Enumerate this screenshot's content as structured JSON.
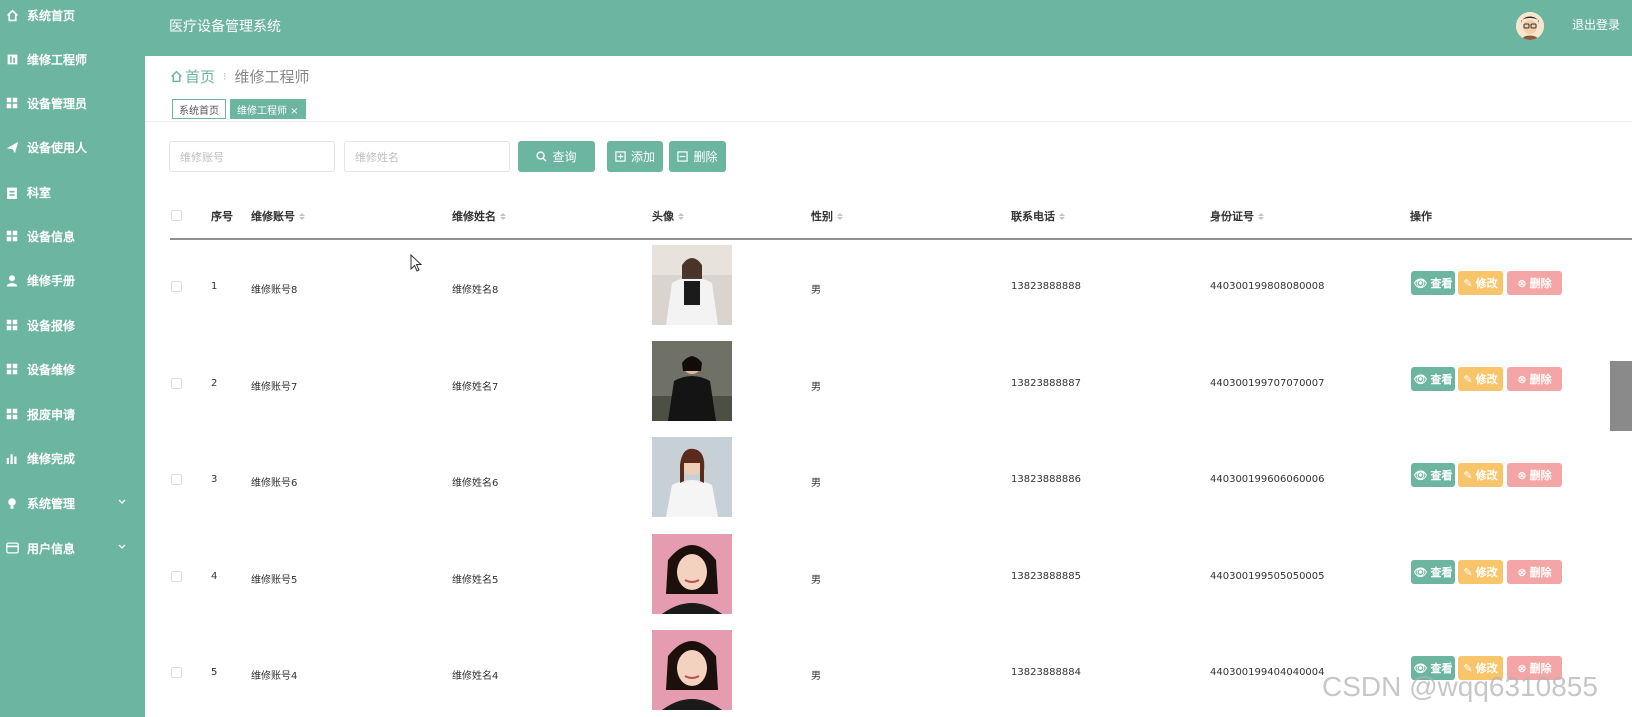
{
  "sidebar": {
    "items": [
      {
        "label": "系统首页",
        "icon": "home-icon"
      },
      {
        "label": "维修工程师",
        "icon": "book-icon"
      },
      {
        "label": "设备管理员",
        "icon": "grid-icon"
      },
      {
        "label": "设备使用人",
        "icon": "send-icon"
      },
      {
        "label": "科室",
        "icon": "clipboard-icon"
      },
      {
        "label": "设备信息",
        "icon": "grid-icon"
      },
      {
        "label": "维修手册",
        "icon": "user-icon"
      },
      {
        "label": "设备报修",
        "icon": "grid-icon"
      },
      {
        "label": "设备维修",
        "icon": "grid-icon"
      },
      {
        "label": "报废申请",
        "icon": "grid-icon"
      },
      {
        "label": "维修完成",
        "icon": "bar-chart-icon"
      },
      {
        "label": "系统管理",
        "icon": "bulb-icon"
      },
      {
        "label": "用户信息",
        "icon": "card-icon"
      }
    ]
  },
  "header": {
    "title": "医疗设备管理系统",
    "logout": "退出登录"
  },
  "breadcrumb": {
    "home": "首页",
    "separator": "⁝",
    "current": "维修工程师"
  },
  "tags": {
    "home": "系统首页",
    "active": "维修工程师 ×"
  },
  "search": {
    "account_placeholder": "维修账号",
    "name_placeholder": "维修姓名",
    "query_label": "查询",
    "add_label": "添加",
    "delete_label": "删除"
  },
  "table": {
    "headers": {
      "index": "序号",
      "account": "维修账号",
      "name": "维修姓名",
      "avatar": "头像",
      "gender": "性别",
      "phone": "联系电话",
      "idcard": "身份证号",
      "action": "操作"
    },
    "rows": [
      {
        "index": "1",
        "account": "维修账号8",
        "name": "维修姓名8",
        "gender": "男",
        "phone": "13823888888",
        "idcard": "440300199808080008"
      },
      {
        "index": "2",
        "account": "维修账号7",
        "name": "维修姓名7",
        "gender": "男",
        "phone": "13823888887",
        "idcard": "440300199707070007"
      },
      {
        "index": "3",
        "account": "维修账号6",
        "name": "维修姓名6",
        "gender": "男",
        "phone": "13823888886",
        "idcard": "440300199606060006"
      },
      {
        "index": "4",
        "account": "维修账号5",
        "name": "维修姓名5",
        "gender": "男",
        "phone": "13823888885",
        "idcard": "440300199505050005"
      },
      {
        "index": "5",
        "account": "维修账号4",
        "name": "维修姓名4",
        "gender": "男",
        "phone": "13823888884",
        "idcard": "440300199404040004"
      }
    ],
    "actions": {
      "view": "查看",
      "edit": "修改",
      "delete": "删除"
    }
  },
  "watermark": "CSDN @wqq6310855",
  "colors": {
    "theme": "#6cb5a1",
    "edit": "#f9c56a",
    "delete": "#f4a5a5"
  }
}
